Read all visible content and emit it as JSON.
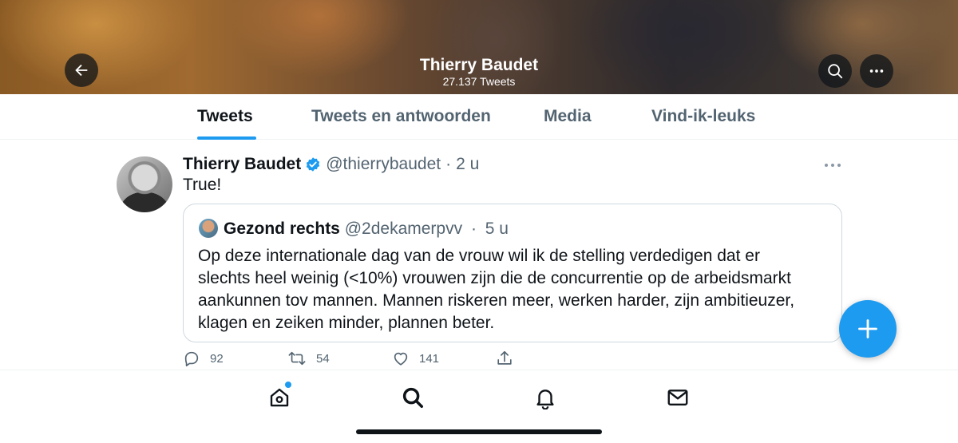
{
  "header": {
    "title": "Thierry Baudet",
    "subtitle": "27.137 Tweets",
    "icons": [
      "back-arrow-icon",
      "search-icon",
      "more-icon"
    ]
  },
  "tabs": [
    {
      "label": "Tweets",
      "active": true
    },
    {
      "label": "Tweets en antwoorden",
      "active": false
    },
    {
      "label": "Media",
      "active": false
    },
    {
      "label": "Vind-ik-leuks",
      "active": false
    }
  ],
  "tweet": {
    "name": "Thierry Baudet",
    "handle": "@thierrybaudet",
    "separator": "·",
    "time": "2 u",
    "text": "True!",
    "quote": {
      "name": "Gezond rechts",
      "handle": "@2dekamerpvv",
      "separator": "·",
      "time": "5 u",
      "lines": [
        "Op deze internationale dag van de vrouw wil ik de stelling verdedigen dat er",
        "slechts heel weinig (<10%) vrouwen zijn die de concurrentie op de arbeidsmarkt",
        "aankunnen tov mannen. Mannen riskeren meer, werken harder, zijn ambitieuzer,",
        "klagen en zeiken minder, plannen beter."
      ]
    },
    "actions": {
      "replies": "92",
      "retweets": "54",
      "likes": "141"
    }
  },
  "bottom_nav": [
    "home-icon",
    "search-icon",
    "notifications-icon",
    "messages-icon"
  ],
  "colors": {
    "accent": "#1d9bf0",
    "text_primary": "#0f1419",
    "text_secondary": "#536471",
    "border": "#cfd9de"
  }
}
